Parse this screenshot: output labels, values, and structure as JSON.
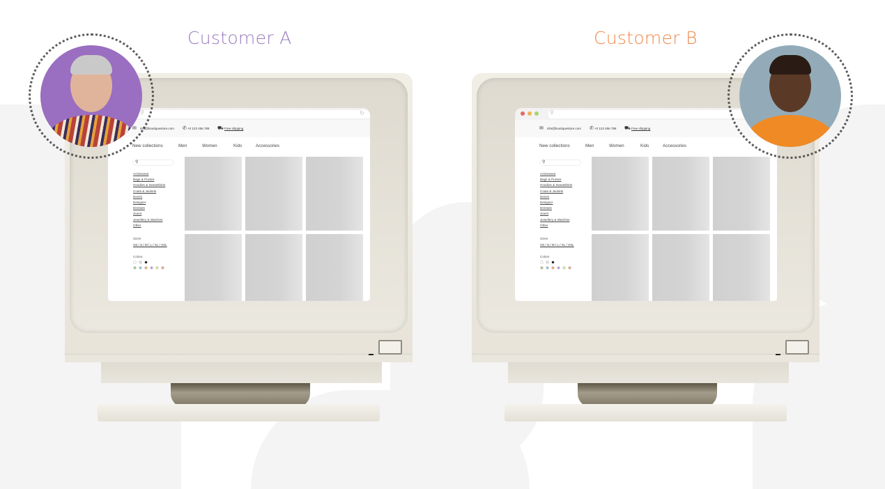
{
  "customers": [
    {
      "title": "Customer A",
      "title_color": "#9a7bbd",
      "browser": "minimal",
      "avatar_bg": "#9a6ec0",
      "shirt": "#b8423a"
    },
    {
      "title": "Customer B",
      "title_color": "#f0894a",
      "browser": "mac",
      "avatar_bg": "#93abb8",
      "shirt": "#f08a24"
    }
  ],
  "store": {
    "email": "info@boutiquestore.com",
    "phone": "+0 123 456 789",
    "shipping": "Free shipping",
    "nav": [
      "New collections",
      "Men",
      "Women",
      "Kids",
      "Accessories"
    ],
    "categories": [
      "Activewear",
      "Bags & Purses",
      "Hoodies & Sweatshirts",
      "Coats & Jackets",
      "Denim",
      "Designer",
      "Dresses",
      "Jeans",
      "Jewellery & Watches",
      "Other"
    ],
    "sizes_label": "Sizes",
    "sizes": "XS / S / M / L / XL / XXL",
    "colors_label": "Colors",
    "colors": [
      "#ffffff",
      "#dddddd",
      "#111111",
      "#9dbf7e",
      "#7fc3d6",
      "#f0a35c",
      "#b49ad8",
      "#d7e08a",
      "#e89a7a"
    ]
  }
}
